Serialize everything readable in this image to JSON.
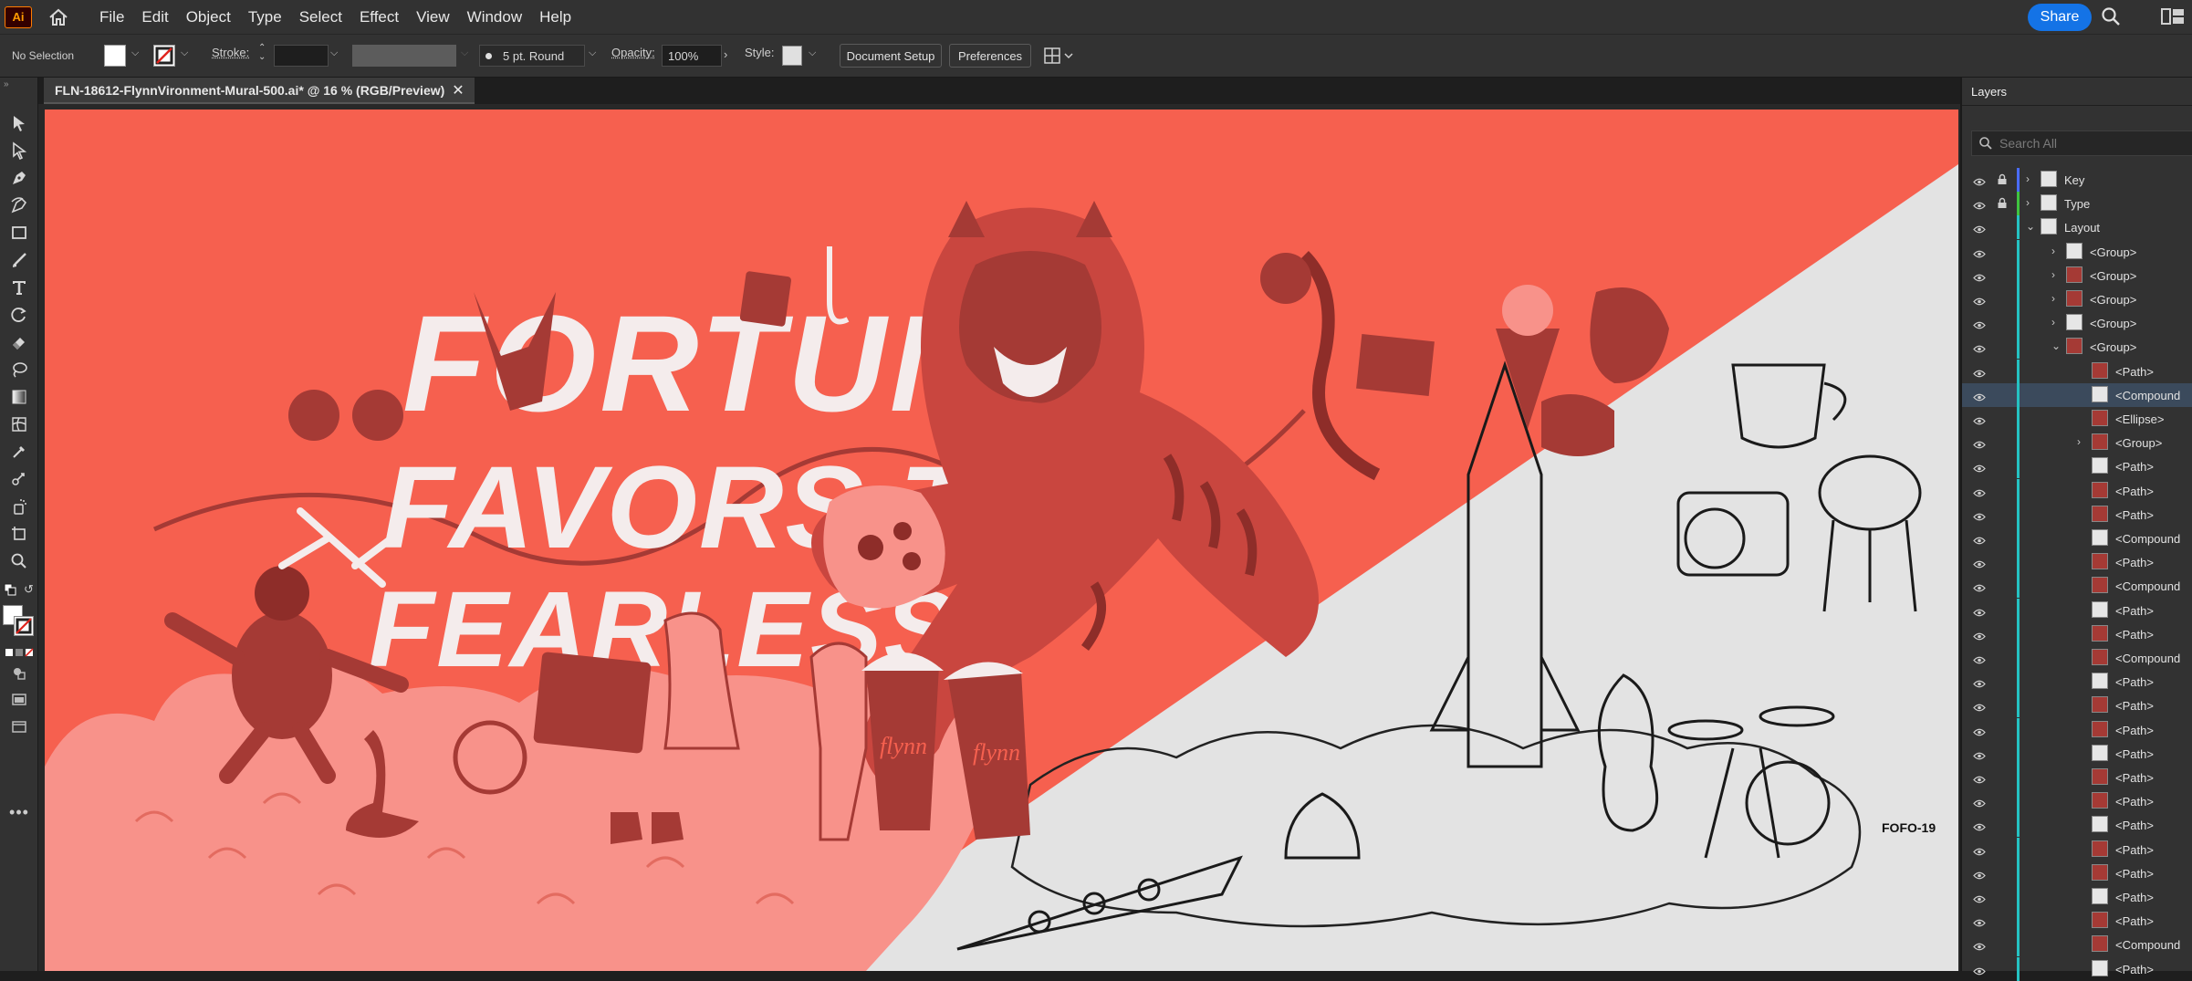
{
  "app": {
    "logo": "Ai",
    "home_icon": "home-icon"
  },
  "menu": {
    "items": [
      "File",
      "Edit",
      "Object",
      "Type",
      "Select",
      "Effect",
      "View",
      "Window",
      "Help"
    ],
    "share": "Share"
  },
  "control": {
    "selection": "No Selection",
    "stroke_label": "Stroke:",
    "brush": "5 pt. Round",
    "opacity_label": "Opacity:",
    "opacity": "100%",
    "style_label": "Style:",
    "doc_setup": "Document Setup",
    "preferences": "Preferences"
  },
  "doc": {
    "tab_title": "FLN-18612-FlynnVironment-Mural-500.ai* @ 16 % (RGB/Preview)",
    "close": "✕"
  },
  "art": {
    "line1": "FORTUNE",
    "line2": "FAVORS THE",
    "line3": "FEARLESS",
    "cup_text": "flynn",
    "signature": "FOFO-19"
  },
  "colors": {
    "coral": "#f6604f",
    "dark_red": "#a53a35",
    "cloud": "#f8928a",
    "light_bg": "#e3e3e3",
    "accent_blue": "#1473e6",
    "layer_teal": "#25c2c2"
  },
  "layers": {
    "tab": "Layers",
    "search_placeholder": "Search All",
    "rows": [
      {
        "name": "Key",
        "level": 0,
        "expand": "collapsed",
        "color": "#4a6cff",
        "locked": true
      },
      {
        "name": "Type",
        "level": 0,
        "expand": "collapsed",
        "color": "#3fc43f",
        "locked": true
      },
      {
        "name": "Layout",
        "level": 0,
        "expand": "expanded",
        "color": "#25c2c2",
        "locked": false
      },
      {
        "name": "<Group>",
        "level": 1,
        "expand": "collapsed",
        "color": "#25c2c2"
      },
      {
        "name": "<Group>",
        "level": 1,
        "expand": "collapsed",
        "color": "#25c2c2"
      },
      {
        "name": "<Group>",
        "level": 1,
        "expand": "collapsed",
        "color": "#25c2c2"
      },
      {
        "name": "<Group>",
        "level": 1,
        "expand": "collapsed",
        "color": "#25c2c2"
      },
      {
        "name": "<Group>",
        "level": 1,
        "expand": "expanded",
        "color": "#25c2c2"
      },
      {
        "name": "<Path>",
        "level": 2,
        "expand": "none",
        "color": "#25c2c2"
      },
      {
        "name": "<Compound",
        "level": 2,
        "expand": "none",
        "color": "#25c2c2",
        "selected": true
      },
      {
        "name": "<Ellipse>",
        "level": 2,
        "expand": "none",
        "color": "#25c2c2"
      },
      {
        "name": "<Group>",
        "level": 2,
        "expand": "collapsed",
        "color": "#25c2c2"
      },
      {
        "name": "<Path>",
        "level": 2,
        "expand": "none",
        "color": "#25c2c2"
      },
      {
        "name": "<Path>",
        "level": 2,
        "expand": "none",
        "color": "#25c2c2"
      },
      {
        "name": "<Path>",
        "level": 2,
        "expand": "none",
        "color": "#25c2c2"
      },
      {
        "name": "<Compound",
        "level": 2,
        "expand": "none",
        "color": "#25c2c2"
      },
      {
        "name": "<Path>",
        "level": 2,
        "expand": "none",
        "color": "#25c2c2"
      },
      {
        "name": "<Compound",
        "level": 2,
        "expand": "none",
        "color": "#25c2c2"
      },
      {
        "name": "<Path>",
        "level": 2,
        "expand": "none",
        "color": "#25c2c2"
      },
      {
        "name": "<Path>",
        "level": 2,
        "expand": "none",
        "color": "#25c2c2"
      },
      {
        "name": "<Compound",
        "level": 2,
        "expand": "none",
        "color": "#25c2c2"
      },
      {
        "name": "<Path>",
        "level": 2,
        "expand": "none",
        "color": "#25c2c2"
      },
      {
        "name": "<Path>",
        "level": 2,
        "expand": "none",
        "color": "#25c2c2"
      },
      {
        "name": "<Path>",
        "level": 2,
        "expand": "none",
        "color": "#25c2c2"
      },
      {
        "name": "<Path>",
        "level": 2,
        "expand": "none",
        "color": "#25c2c2"
      },
      {
        "name": "<Path>",
        "level": 2,
        "expand": "none",
        "color": "#25c2c2"
      },
      {
        "name": "<Path>",
        "level": 2,
        "expand": "none",
        "color": "#25c2c2"
      },
      {
        "name": "<Path>",
        "level": 2,
        "expand": "none",
        "color": "#25c2c2"
      },
      {
        "name": "<Path>",
        "level": 2,
        "expand": "none",
        "color": "#25c2c2"
      },
      {
        "name": "<Path>",
        "level": 2,
        "expand": "none",
        "color": "#25c2c2"
      },
      {
        "name": "<Path>",
        "level": 2,
        "expand": "none",
        "color": "#25c2c2"
      },
      {
        "name": "<Path>",
        "level": 2,
        "expand": "none",
        "color": "#25c2c2"
      },
      {
        "name": "<Compound",
        "level": 2,
        "expand": "none",
        "color": "#25c2c2"
      },
      {
        "name": "<Path>",
        "level": 2,
        "expand": "none",
        "color": "#25c2c2"
      }
    ]
  }
}
